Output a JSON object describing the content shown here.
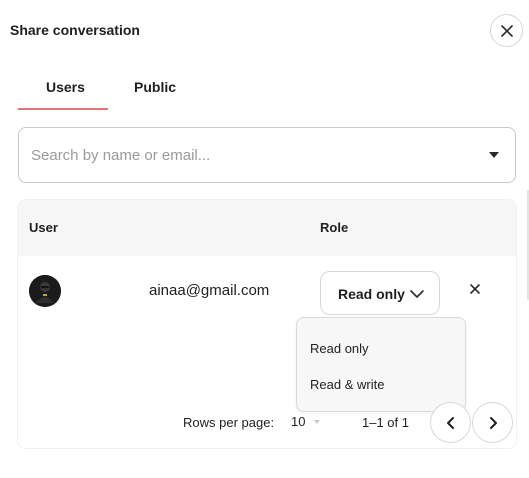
{
  "dialog": {
    "title": "Share conversation",
    "close_icon": "close-icon"
  },
  "tabs": [
    {
      "label": "Users",
      "active": true
    },
    {
      "label": "Public",
      "active": false
    }
  ],
  "accent_color": "#e8717a",
  "search": {
    "placeholder": "Search by name or email...",
    "value": "",
    "dropdown_icon": "caret-down-icon"
  },
  "table": {
    "headers": {
      "user": "User",
      "role": "Role"
    },
    "rows": [
      {
        "avatar_icon": "avatar",
        "email": "ainaa@gmail.com",
        "role": "Read only",
        "remove_icon": "remove-icon"
      }
    ],
    "role_menu": {
      "open": true,
      "options": [
        "Read only",
        "Read & write"
      ]
    },
    "pagination": {
      "rows_per_page_label": "Rows per page:",
      "rows_per_page": "10",
      "range": "1–1 of 1",
      "prev_icon": "chevron-left-icon",
      "next_icon": "chevron-right-icon"
    }
  }
}
